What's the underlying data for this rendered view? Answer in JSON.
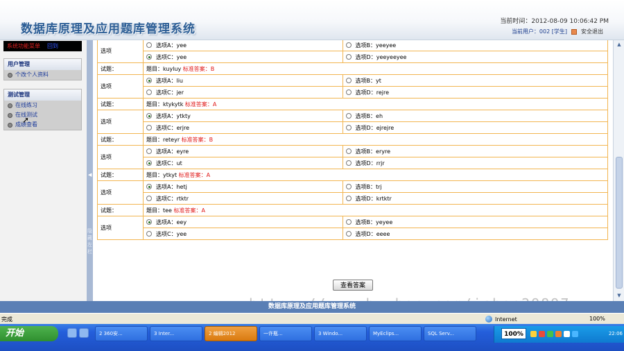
{
  "header": {
    "title": "数据库原理及应用题库管理系统",
    "time_text": "当前时间：2012-08-09 10:06:42 PM",
    "user_text": "当前用户：002 [学生]",
    "logout": "安全退出"
  },
  "sidebar": {
    "top_text": "系统功能菜单",
    "top_sep": "回到",
    "groups": [
      {
        "title": "用户管理",
        "items": [
          "个改个人资料"
        ]
      },
      {
        "title": "测试管理",
        "items": [
          "在线练习",
          "在线测试",
          "成绩查看"
        ]
      }
    ]
  },
  "splitter": {
    "vertical_text": "隐藏左栏"
  },
  "labels": {
    "option": "选项",
    "question": "试题：",
    "stem_prefix": "题目：",
    "answer_prefix": "标准答案："
  },
  "questions": [
    {
      "options": [
        {
          "label": "选项A：yee",
          "selected": false
        },
        {
          "label": "选项B：yeeyee",
          "selected": false
        },
        {
          "label": "选项C：yee",
          "selected": true
        },
        {
          "label": "选项D：yeeyeeyee",
          "selected": false
        }
      ]
    },
    {
      "stem": "kuyluy",
      "answer": "B",
      "options": [
        {
          "label": "选项A：liu",
          "selected": true
        },
        {
          "label": "选项B：yt",
          "selected": false
        },
        {
          "label": "选项C：jer",
          "selected": false
        },
        {
          "label": "选项D：rejre",
          "selected": false
        }
      ]
    },
    {
      "stem": "ktykytk",
      "answer": "A",
      "options": [
        {
          "label": "选项A：ytkty",
          "selected": true
        },
        {
          "label": "选项B：eh",
          "selected": false
        },
        {
          "label": "选项C：erjre",
          "selected": false
        },
        {
          "label": "选项D：ejrejre",
          "selected": false
        }
      ]
    },
    {
      "stem": "reteyr",
      "answer": "B",
      "options": [
        {
          "label": "选项A：eyre",
          "selected": false
        },
        {
          "label": "选项B：eryre",
          "selected": false
        },
        {
          "label": "选项C：ut",
          "selected": true
        },
        {
          "label": "选项D：rrjr",
          "selected": false
        }
      ]
    },
    {
      "stem": "ytkyt",
      "answer": "A",
      "options": [
        {
          "label": "选项A：hetj",
          "selected": true
        },
        {
          "label": "选项B：trj",
          "selected": false
        },
        {
          "label": "选项C：rtktr",
          "selected": false
        },
        {
          "label": "选项D：krtktr",
          "selected": false
        }
      ]
    },
    {
      "stem": "tee",
      "answer": "A",
      "options": [
        {
          "label": "选项A：eey",
          "selected": true
        },
        {
          "label": "选项B：yeyee",
          "selected": false
        },
        {
          "label": "选项C：yee",
          "selected": false
        },
        {
          "label": "选项D：eeee",
          "selected": false
        }
      ]
    }
  ],
  "view_answer_button": "查看答案",
  "watermark": "https://www.huzhan.com/ishop29897",
  "footer": "数据库原理及应用题库管理系统",
  "statusbar": {
    "done": "完成",
    "zone": "Internet",
    "zoom": "100%"
  },
  "taskbar": {
    "start": "开始",
    "tasks": [
      "2 360安...",
      "3 Inter...",
      "2 编辑2012",
      "一许瓶...",
      "3 Windo...",
      "MyEclips...",
      "SQL Serv..."
    ],
    "active_index": 2,
    "percent": "100%",
    "clock": "22:06"
  },
  "colors": {
    "answer": "#e01818",
    "footer": "#5a7fb5",
    "border": "#f2b550",
    "title": "#2b5d95"
  }
}
